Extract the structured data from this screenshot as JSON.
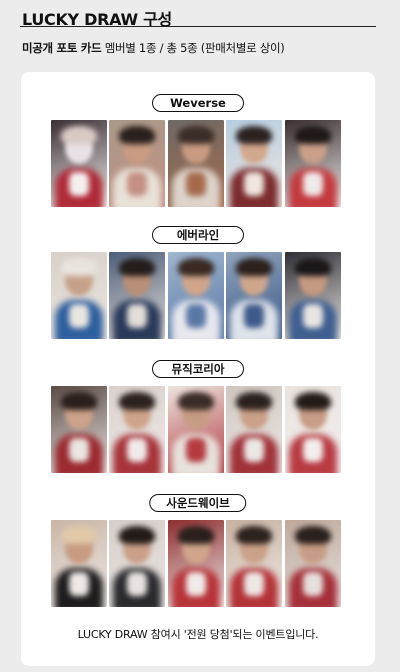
{
  "header": {
    "title": "LUCKY DRAW 구성"
  },
  "subtitle": {
    "strong": "미공개 포토 카드",
    "rest": " 멤버별 1종 / 총 5종 (판매처별로 상이)"
  },
  "sections": [
    {
      "label": "Weverse"
    },
    {
      "label": "에버라인"
    },
    {
      "label": "뮤직코리아"
    },
    {
      "label": "사운드웨이브"
    }
  ],
  "footer": {
    "note": "LUCKY DRAW 참여시 '전원 당첨'되는 이벤트입니다."
  },
  "photo_palettes": [
    [
      [
        "#3a2f33",
        "#d9c9c3",
        "#e8e2e6",
        "#b02a38",
        "#f4f0f0"
      ],
      [
        "#a99a8a",
        "#2a201c",
        "#c99b82",
        "#e9e2d8",
        "#c48f84"
      ],
      [
        "#6e6a66",
        "#3b2d28",
        "#c99c82",
        "#ddd4cc",
        "#a56a4c"
      ],
      [
        "#b6cde0",
        "#2b2220",
        "#d2a88e",
        "#7d2c2e",
        "#efe7e0"
      ],
      [
        "#3a2f30",
        "#1e1818",
        "#caa089",
        "#c33a3f",
        "#f0ebeb"
      ]
    ],
    [
      [
        "#d8d0c8",
        "#e8e4de",
        "#c6a189",
        "#2e5f9e",
        "#eae6e2"
      ],
      [
        "#4d5f7a",
        "#231d1b",
        "#b98f78",
        "#2a3a5a",
        "#e3ddd9"
      ],
      [
        "#9fb6cf",
        "#3a2a22",
        "#d0a58a",
        "#e8e8ee",
        "#5a78a6"
      ],
      [
        "#8fa3bb",
        "#2b211d",
        "#cfa68c",
        "#dfe3ea",
        "#3d5a8a"
      ],
      [
        "#2f2f36",
        "#1b1718",
        "#c69a82",
        "#3f5f90",
        "#e9e5e2"
      ]
    ],
    [
      [
        "#5a4a45",
        "#2a1f1b",
        "#cda28a",
        "#9c2a30",
        "#ebe6e3"
      ],
      [
        "#d9d0cb",
        "#2b2220",
        "#cfa48b",
        "#a7343a",
        "#f0ebea"
      ],
      [
        "#ece5df",
        "#3a2c26",
        "#c79c84",
        "#e7e2dc",
        "#b43a40"
      ],
      [
        "#cfc6c0",
        "#2a211e",
        "#cba088",
        "#a13239",
        "#ece8e6"
      ],
      [
        "#e9e3df",
        "#241c19",
        "#c89c85",
        "#b83b42",
        "#f3efee"
      ]
    ],
    [
      [
        "#c9b6a8",
        "#e0c8a8",
        "#c79b82",
        "#1e1c1d",
        "#eee9e6"
      ],
      [
        "#d7cfca",
        "#231b18",
        "#caa088",
        "#2a2a2e",
        "#e9e4e2"
      ],
      [
        "#8f2d2f",
        "#2a1f1c",
        "#cfa58c",
        "#b8343a",
        "#f0ebe8"
      ],
      [
        "#c7b2a2",
        "#2c221e",
        "#cba189",
        "#b43339",
        "#efe9e6"
      ],
      [
        "#bfa99b",
        "#2a201d",
        "#c79c84",
        "#a5303a",
        "#e6e0dd"
      ]
    ]
  ]
}
